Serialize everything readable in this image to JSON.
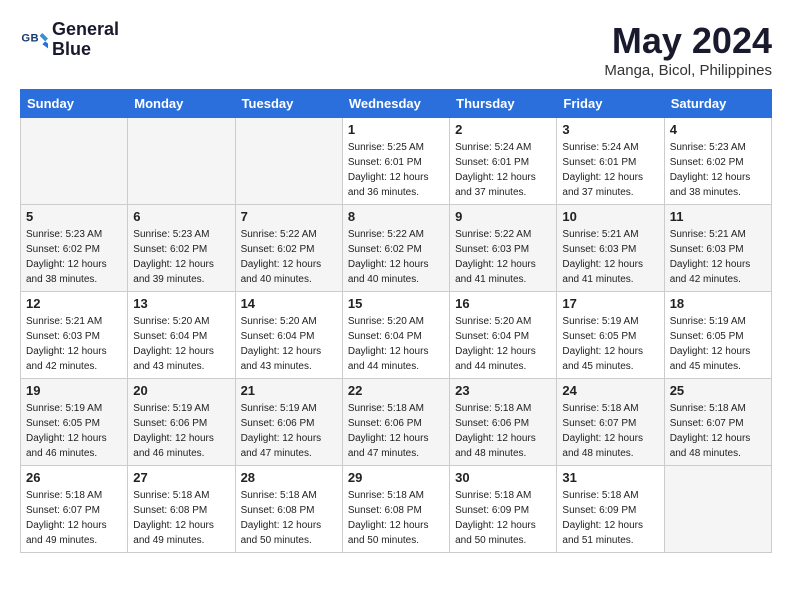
{
  "header": {
    "logo_line1": "General",
    "logo_line2": "Blue",
    "month": "May 2024",
    "location": "Manga, Bicol, Philippines"
  },
  "weekdays": [
    "Sunday",
    "Monday",
    "Tuesday",
    "Wednesday",
    "Thursday",
    "Friday",
    "Saturday"
  ],
  "weeks": [
    [
      {
        "day": "",
        "info": ""
      },
      {
        "day": "",
        "info": ""
      },
      {
        "day": "",
        "info": ""
      },
      {
        "day": "1",
        "info": "Sunrise: 5:25 AM\nSunset: 6:01 PM\nDaylight: 12 hours\nand 36 minutes."
      },
      {
        "day": "2",
        "info": "Sunrise: 5:24 AM\nSunset: 6:01 PM\nDaylight: 12 hours\nand 37 minutes."
      },
      {
        "day": "3",
        "info": "Sunrise: 5:24 AM\nSunset: 6:01 PM\nDaylight: 12 hours\nand 37 minutes."
      },
      {
        "day": "4",
        "info": "Sunrise: 5:23 AM\nSunset: 6:02 PM\nDaylight: 12 hours\nand 38 minutes."
      }
    ],
    [
      {
        "day": "5",
        "info": "Sunrise: 5:23 AM\nSunset: 6:02 PM\nDaylight: 12 hours\nand 38 minutes."
      },
      {
        "day": "6",
        "info": "Sunrise: 5:23 AM\nSunset: 6:02 PM\nDaylight: 12 hours\nand 39 minutes."
      },
      {
        "day": "7",
        "info": "Sunrise: 5:22 AM\nSunset: 6:02 PM\nDaylight: 12 hours\nand 40 minutes."
      },
      {
        "day": "8",
        "info": "Sunrise: 5:22 AM\nSunset: 6:02 PM\nDaylight: 12 hours\nand 40 minutes."
      },
      {
        "day": "9",
        "info": "Sunrise: 5:22 AM\nSunset: 6:03 PM\nDaylight: 12 hours\nand 41 minutes."
      },
      {
        "day": "10",
        "info": "Sunrise: 5:21 AM\nSunset: 6:03 PM\nDaylight: 12 hours\nand 41 minutes."
      },
      {
        "day": "11",
        "info": "Sunrise: 5:21 AM\nSunset: 6:03 PM\nDaylight: 12 hours\nand 42 minutes."
      }
    ],
    [
      {
        "day": "12",
        "info": "Sunrise: 5:21 AM\nSunset: 6:03 PM\nDaylight: 12 hours\nand 42 minutes."
      },
      {
        "day": "13",
        "info": "Sunrise: 5:20 AM\nSunset: 6:04 PM\nDaylight: 12 hours\nand 43 minutes."
      },
      {
        "day": "14",
        "info": "Sunrise: 5:20 AM\nSunset: 6:04 PM\nDaylight: 12 hours\nand 43 minutes."
      },
      {
        "day": "15",
        "info": "Sunrise: 5:20 AM\nSunset: 6:04 PM\nDaylight: 12 hours\nand 44 minutes."
      },
      {
        "day": "16",
        "info": "Sunrise: 5:20 AM\nSunset: 6:04 PM\nDaylight: 12 hours\nand 44 minutes."
      },
      {
        "day": "17",
        "info": "Sunrise: 5:19 AM\nSunset: 6:05 PM\nDaylight: 12 hours\nand 45 minutes."
      },
      {
        "day": "18",
        "info": "Sunrise: 5:19 AM\nSunset: 6:05 PM\nDaylight: 12 hours\nand 45 minutes."
      }
    ],
    [
      {
        "day": "19",
        "info": "Sunrise: 5:19 AM\nSunset: 6:05 PM\nDaylight: 12 hours\nand 46 minutes."
      },
      {
        "day": "20",
        "info": "Sunrise: 5:19 AM\nSunset: 6:06 PM\nDaylight: 12 hours\nand 46 minutes."
      },
      {
        "day": "21",
        "info": "Sunrise: 5:19 AM\nSunset: 6:06 PM\nDaylight: 12 hours\nand 47 minutes."
      },
      {
        "day": "22",
        "info": "Sunrise: 5:18 AM\nSunset: 6:06 PM\nDaylight: 12 hours\nand 47 minutes."
      },
      {
        "day": "23",
        "info": "Sunrise: 5:18 AM\nSunset: 6:06 PM\nDaylight: 12 hours\nand 48 minutes."
      },
      {
        "day": "24",
        "info": "Sunrise: 5:18 AM\nSunset: 6:07 PM\nDaylight: 12 hours\nand 48 minutes."
      },
      {
        "day": "25",
        "info": "Sunrise: 5:18 AM\nSunset: 6:07 PM\nDaylight: 12 hours\nand 48 minutes."
      }
    ],
    [
      {
        "day": "26",
        "info": "Sunrise: 5:18 AM\nSunset: 6:07 PM\nDaylight: 12 hours\nand 49 minutes."
      },
      {
        "day": "27",
        "info": "Sunrise: 5:18 AM\nSunset: 6:08 PM\nDaylight: 12 hours\nand 49 minutes."
      },
      {
        "day": "28",
        "info": "Sunrise: 5:18 AM\nSunset: 6:08 PM\nDaylight: 12 hours\nand 50 minutes."
      },
      {
        "day": "29",
        "info": "Sunrise: 5:18 AM\nSunset: 6:08 PM\nDaylight: 12 hours\nand 50 minutes."
      },
      {
        "day": "30",
        "info": "Sunrise: 5:18 AM\nSunset: 6:09 PM\nDaylight: 12 hours\nand 50 minutes."
      },
      {
        "day": "31",
        "info": "Sunrise: 5:18 AM\nSunset: 6:09 PM\nDaylight: 12 hours\nand 51 minutes."
      },
      {
        "day": "",
        "info": ""
      }
    ]
  ]
}
